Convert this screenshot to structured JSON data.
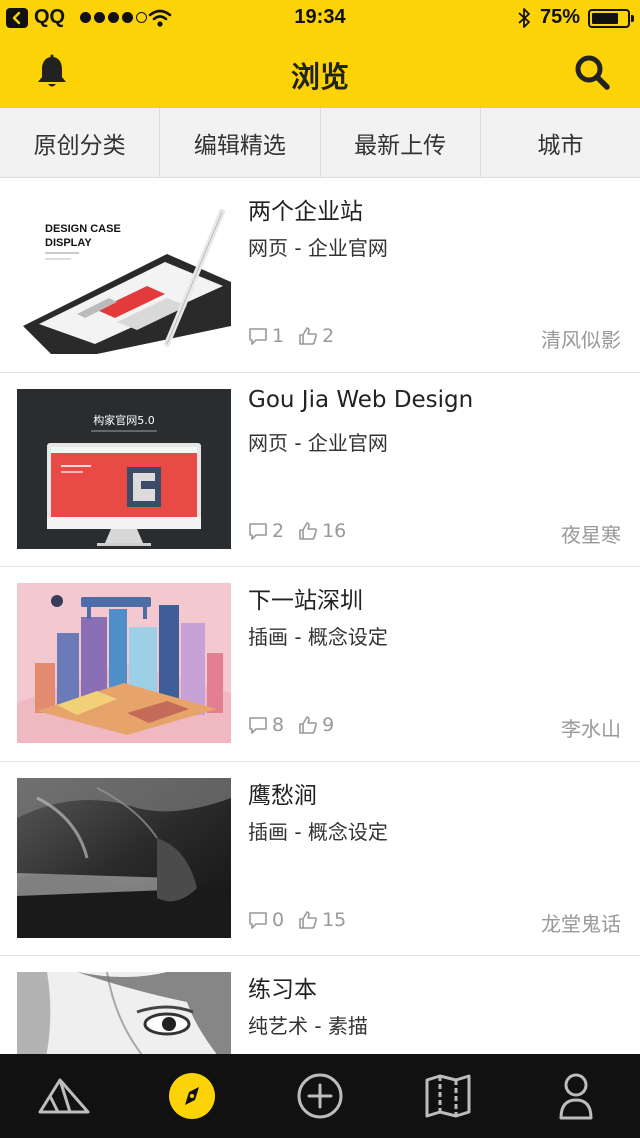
{
  "status_bar": {
    "carrier": "QQ",
    "time": "19:34",
    "battery": "75%",
    "battery_level": 0.75
  },
  "nav": {
    "title": "浏览",
    "left_icon": "bell-icon",
    "right_icon": "search-icon"
  },
  "tabs": [
    {
      "label": "原创分类"
    },
    {
      "label": "编辑精选"
    },
    {
      "label": "最新上传"
    },
    {
      "label": "城市"
    }
  ],
  "feed": [
    {
      "title": "两个企业站",
      "category": "网页 - 企业官网",
      "comments": "1",
      "likes": "2",
      "author": "清风似影"
    },
    {
      "title": "Gou Jia Web Design",
      "category": "网页 - 企业官网",
      "comments": "2",
      "likes": "16",
      "author": "夜星寒"
    },
    {
      "title": "下一站深圳",
      "category": "插画 - 概念设定",
      "comments": "8",
      "likes": "9",
      "author": "李水山"
    },
    {
      "title": "鹰愁涧",
      "category": "插画 - 概念设定",
      "comments": "0",
      "likes": "15",
      "author": "龙堂鬼话"
    },
    {
      "title": "练习本",
      "category": "纯艺术 - 素描",
      "comments": "",
      "likes": "",
      "author": ""
    }
  ],
  "thumb_text": {
    "design_case_line1": "DESIGN CASE",
    "design_case_line2": "DISPLAY",
    "goujia_title": "构家官网5.0"
  },
  "bottom_tabs": [
    {
      "icon": "discover-mountain-icon"
    },
    {
      "icon": "compass-icon",
      "active": true
    },
    {
      "icon": "add-circle-icon"
    },
    {
      "icon": "map-icon"
    },
    {
      "icon": "profile-icon"
    }
  ],
  "colors": {
    "accent": "#fcd307",
    "bottom_bar": "#111111",
    "tab_bg": "#f2f2f2"
  }
}
